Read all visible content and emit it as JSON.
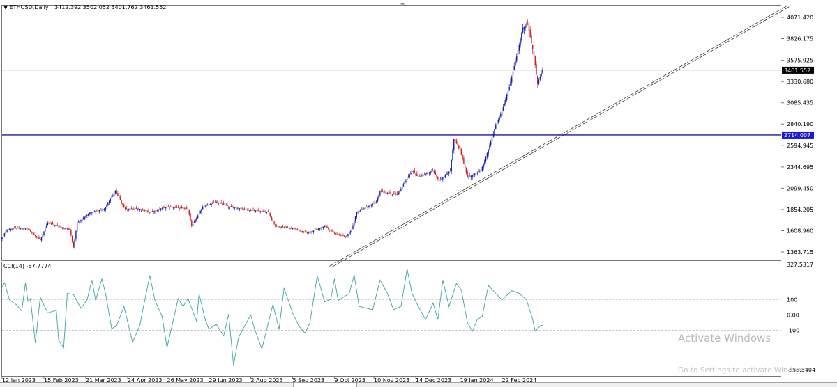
{
  "header": {
    "symbol": "ETHUSD,Daily",
    "ohlc": "3412.392 3502.052 3401.762 3461.552"
  },
  "indicator": {
    "label": "CCI(14) -67.7774"
  },
  "watermark": {
    "title": "Activate Windows",
    "subtitle": "Go to Settings to activate Windows."
  },
  "colors": {
    "up": "#1a1aa8",
    "down": "#c41e1e",
    "cci": "#3aa3a3",
    "hline": "#1a1a90",
    "bid": "#c8c8c8"
  },
  "chart_data": [
    {
      "type": "candlestick",
      "title": "ETHUSD,Daily",
      "start_date": "12 Jan 2023",
      "ylim": [
        1363.715,
        4071.42
      ],
      "y_ticks": [
        "4071.420",
        "3826.175",
        "3575.925",
        "3330.680",
        "3085.435",
        "2840.190",
        "2594.945",
        "2344.695",
        "2099.450",
        "1854.205",
        "1608.960",
        "1363.715"
      ],
      "y_tick_values": [
        4071.42,
        3826.175,
        3575.925,
        3330.68,
        3085.435,
        2840.19,
        2594.945,
        2344.695,
        2099.45,
        1854.205,
        1608.96,
        1363.715
      ],
      "x_ticks": [
        "12 Jan 2023",
        "15 Feb 2023",
        "21 Mar 2023",
        "24 Apr 2023",
        "26 May 2023",
        "29 Jun 2023",
        "2 Aug 2023",
        "5 Sep 2023",
        "9 Oct 2023",
        "10 Nov 2023",
        "14 Dec 2023",
        "19 Jan 2024",
        "22 Feb 2024"
      ],
      "x_tick_days": [
        0,
        34,
        68,
        102,
        134,
        168,
        202,
        236,
        270,
        302,
        336,
        372,
        406
      ],
      "close_points": [
        [
          0,
          1540
        ],
        [
          4,
          1620
        ],
        [
          10,
          1637
        ],
        [
          21,
          1630
        ],
        [
          31,
          1500
        ],
        [
          37,
          1700
        ],
        [
          55,
          1621
        ],
        [
          58,
          1420
        ],
        [
          61,
          1701
        ],
        [
          72,
          1822
        ],
        [
          83,
          1862
        ],
        [
          92,
          2063
        ],
        [
          100,
          1862
        ],
        [
          112,
          1862
        ],
        [
          120,
          1822
        ],
        [
          134,
          1886
        ],
        [
          151,
          1862
        ],
        [
          154,
          1661
        ],
        [
          163,
          1886
        ],
        [
          174,
          1942
        ],
        [
          185,
          1886
        ],
        [
          202,
          1846
        ],
        [
          216,
          1822
        ],
        [
          222,
          1661
        ],
        [
          236,
          1637
        ],
        [
          248,
          1581
        ],
        [
          262,
          1661
        ],
        [
          270,
          1581
        ],
        [
          279,
          1540
        ],
        [
          284,
          1621
        ],
        [
          288,
          1822
        ],
        [
          304,
          1942
        ],
        [
          307,
          2063
        ],
        [
          321,
          2023
        ],
        [
          333,
          2304
        ],
        [
          338,
          2223
        ],
        [
          350,
          2304
        ],
        [
          355,
          2183
        ],
        [
          364,
          2304
        ],
        [
          367,
          2665
        ],
        [
          372,
          2545
        ],
        [
          378,
          2223
        ],
        [
          389,
          2304
        ],
        [
          395,
          2545
        ],
        [
          401,
          2826
        ],
        [
          406,
          2987
        ],
        [
          412,
          3268
        ],
        [
          418,
          3630
        ],
        [
          423,
          3951
        ],
        [
          427,
          3991
        ],
        [
          432,
          3630
        ],
        [
          435,
          3308
        ],
        [
          439,
          3461.552
        ]
      ],
      "last_price": {
        "value": 3461.552,
        "label": "3461.552"
      },
      "horizontal_line": {
        "value": 2714.007,
        "label": "2714.007"
      },
      "trendline": {
        "from": [
          266,
          1200
        ],
        "to": [
          637,
          4200
        ]
      }
    },
    {
      "type": "line",
      "title": "CCI(14)",
      "ylim": [
        -355.5404,
        327.5317
      ],
      "y_ticks": [
        "327.5317",
        "100",
        "0.00",
        "-100",
        "-355.5404"
      ],
      "levels": [
        100,
        -100
      ],
      "points": [
        [
          0,
          183
        ],
        [
          2,
          208
        ],
        [
          6,
          98
        ],
        [
          12,
          64
        ],
        [
          16,
          26
        ],
        [
          19,
          208
        ],
        [
          21,
          89
        ],
        [
          23,
          106
        ],
        [
          27,
          -183
        ],
        [
          31,
          115
        ],
        [
          37,
          13
        ],
        [
          44,
          30
        ],
        [
          46,
          -166
        ],
        [
          50,
          -213
        ],
        [
          53,
          140
        ],
        [
          58,
          132
        ],
        [
          64,
          43
        ],
        [
          69,
          98
        ],
        [
          73,
          226
        ],
        [
          76,
          94
        ],
        [
          81,
          234
        ],
        [
          84,
          140
        ],
        [
          89,
          -89
        ],
        [
          93,
          -72
        ],
        [
          99,
          55
        ],
        [
          106,
          -179
        ],
        [
          112,
          -64
        ],
        [
          114,
          21
        ],
        [
          120,
          255
        ],
        [
          124,
          98
        ],
        [
          130,
          -9
        ],
        [
          134,
          -213
        ],
        [
          143,
          106
        ],
        [
          147,
          55
        ],
        [
          151,
          106
        ],
        [
          158,
          -43
        ],
        [
          160,
          136
        ],
        [
          165,
          -30
        ],
        [
          168,
          -94
        ],
        [
          174,
          -60
        ],
        [
          180,
          -136
        ],
        [
          184,
          4
        ],
        [
          188,
          -328
        ],
        [
          192,
          -149
        ],
        [
          197,
          -72
        ],
        [
          202,
          0
        ],
        [
          205,
          -89
        ],
        [
          211,
          -221
        ],
        [
          220,
          68
        ],
        [
          225,
          -94
        ],
        [
          229,
          174
        ],
        [
          236,
          13
        ],
        [
          241,
          -72
        ],
        [
          246,
          -119
        ],
        [
          250,
          -51
        ],
        [
          256,
          255
        ],
        [
          262,
          85
        ],
        [
          267,
          102
        ],
        [
          270,
          234
        ],
        [
          273,
          94
        ],
        [
          282,
          140
        ],
        [
          286,
          260
        ],
        [
          290,
          55
        ],
        [
          301,
          34
        ],
        [
          307,
          226
        ],
        [
          313,
          140
        ],
        [
          318,
          34
        ],
        [
          324,
          55
        ],
        [
          329,
          298
        ],
        [
          333,
          140
        ],
        [
          338,
          55
        ],
        [
          344,
          -30
        ],
        [
          350,
          77
        ],
        [
          354,
          -30
        ],
        [
          358,
          226
        ],
        [
          363,
          55
        ],
        [
          369,
          204
        ],
        [
          373,
          162
        ],
        [
          378,
          -51
        ],
        [
          382,
          -106
        ],
        [
          386,
          -30
        ],
        [
          390,
          -9
        ],
        [
          395,
          191
        ],
        [
          401,
          140
        ],
        [
          406,
          98
        ],
        [
          414,
          157
        ],
        [
          420,
          140
        ],
        [
          426,
          98
        ],
        [
          431,
          -30
        ],
        [
          433,
          -106
        ],
        [
          437,
          -72
        ],
        [
          439,
          -67.7774
        ]
      ]
    }
  ]
}
